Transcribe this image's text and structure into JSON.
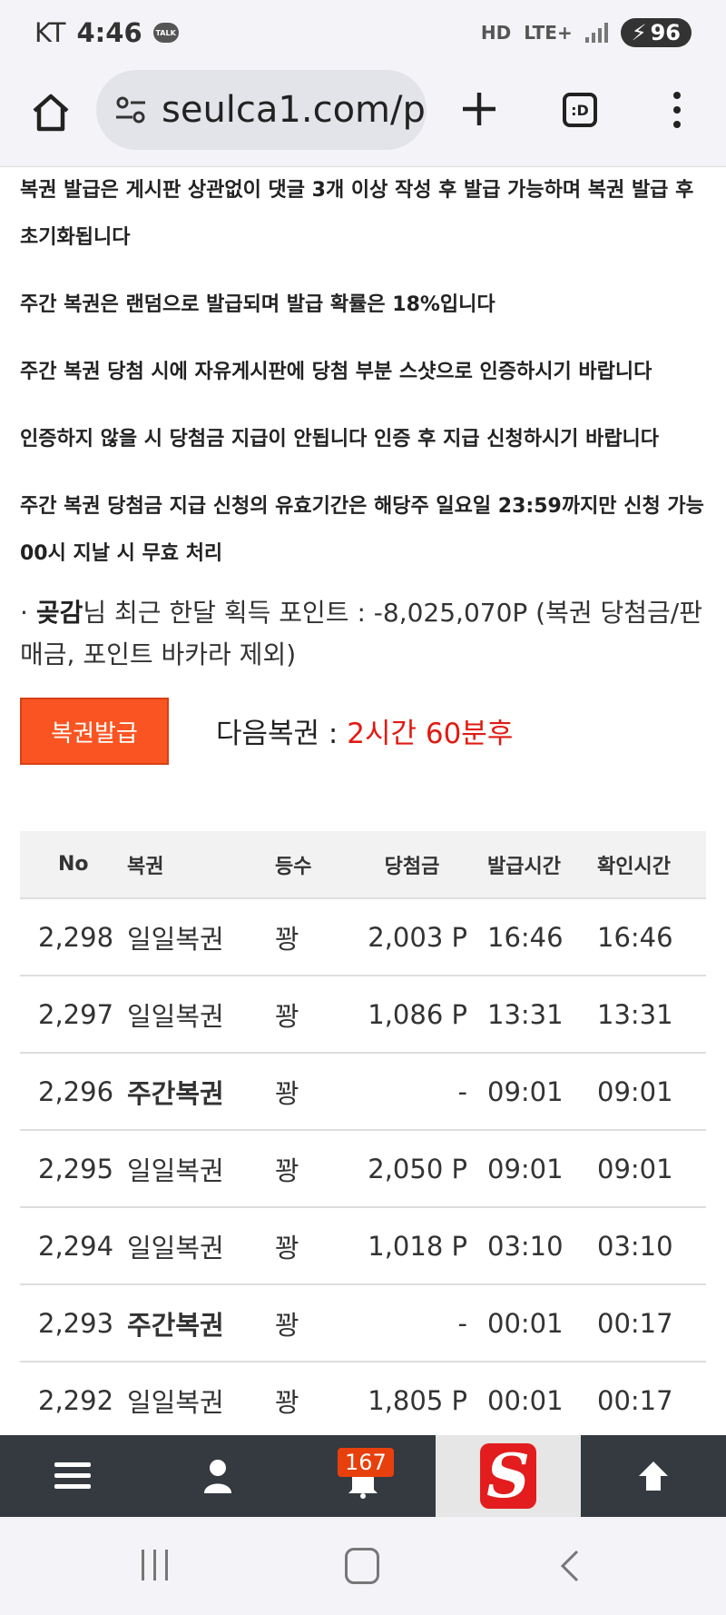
{
  "status_bar": {
    "carrier": "KT",
    "time": "4:46",
    "talk_label": "TALK",
    "hd": "HD",
    "network": "LTE+",
    "battery": "96"
  },
  "browser": {
    "url": "seulca1.com/p",
    "tab_label": ":D"
  },
  "notices": [
    "복권 발급은 게시판 상관없이 댓글 3개 이상 작성 후 발급 가능하며 복권 발급 후 초기화됩니다",
    "주간 복권은 랜덤으로 발급되며 발급 확률은 18%입니다",
    "주간 복권 당첨 시에 자유게시판에 당첨 부분 스샷으로 인증하시기 바랍니다",
    "인증하지 않을 시 당첨금 지급이 안됩니다 인증 후 지급 신청하시기 바랍니다",
    "주간 복권 당첨금 지급 신청의 유효기간은 해당주 일요일 23:59까지만 신청 가능 00시 지날 시 무효 처리"
  ],
  "points": {
    "bullet": " · ",
    "user": "곶감",
    "text": "님 최근 한달 획득 포인트 : -8,025,070P (복권 당첨금/판매금, 포인트 바카라 제외)"
  },
  "issue": {
    "button_label": "복권발급",
    "next_label": "다음복권 : ",
    "next_value": "2시간 60분후"
  },
  "table": {
    "headers": [
      "No",
      "복권",
      "등수",
      "당첨금",
      "발급시간",
      "확인시간"
    ],
    "rows": [
      {
        "no": "2,298",
        "type": "일일복권",
        "weekly": false,
        "rank": "꽝",
        "prize": "2,003 P",
        "issued": "16:46",
        "checked": "16:46"
      },
      {
        "no": "2,297",
        "type": "일일복권",
        "weekly": false,
        "rank": "꽝",
        "prize": "1,086 P",
        "issued": "13:31",
        "checked": "13:31"
      },
      {
        "no": "2,296",
        "type": "주간복권",
        "weekly": true,
        "rank": "꽝",
        "prize": "-",
        "issued": "09:01",
        "checked": "09:01"
      },
      {
        "no": "2,295",
        "type": "일일복권",
        "weekly": false,
        "rank": "꽝",
        "prize": "2,050 P",
        "issued": "09:01",
        "checked": "09:01"
      },
      {
        "no": "2,294",
        "type": "일일복권",
        "weekly": false,
        "rank": "꽝",
        "prize": "1,018 P",
        "issued": "03:10",
        "checked": "03:10"
      },
      {
        "no": "2,293",
        "type": "주간복권",
        "weekly": true,
        "rank": "꽝",
        "prize": "-",
        "issued": "00:01",
        "checked": "00:17"
      },
      {
        "no": "2,292",
        "type": "일일복권",
        "weekly": false,
        "rank": "꽝",
        "prize": "1,805 P",
        "issued": "00:01",
        "checked": "00:17"
      }
    ]
  },
  "site_nav": {
    "notification_count": "167",
    "logo_letter": "S"
  },
  "colors": {
    "accent": "#f95421",
    "next_time": "#e01b12",
    "nav_bg": "#343a40",
    "logo": "#e31d1d"
  },
  "icons": [
    "talk-icon",
    "hd-icon",
    "lte-icon",
    "signal-icon",
    "battery-icon",
    "home-icon",
    "tune-icon",
    "plus-icon",
    "tabs-icon",
    "more-vert-icon",
    "hamburger-icon",
    "user-icon",
    "bell-icon",
    "arrow-up-icon",
    "recents-icon",
    "home-nav-icon",
    "back-icon"
  ]
}
